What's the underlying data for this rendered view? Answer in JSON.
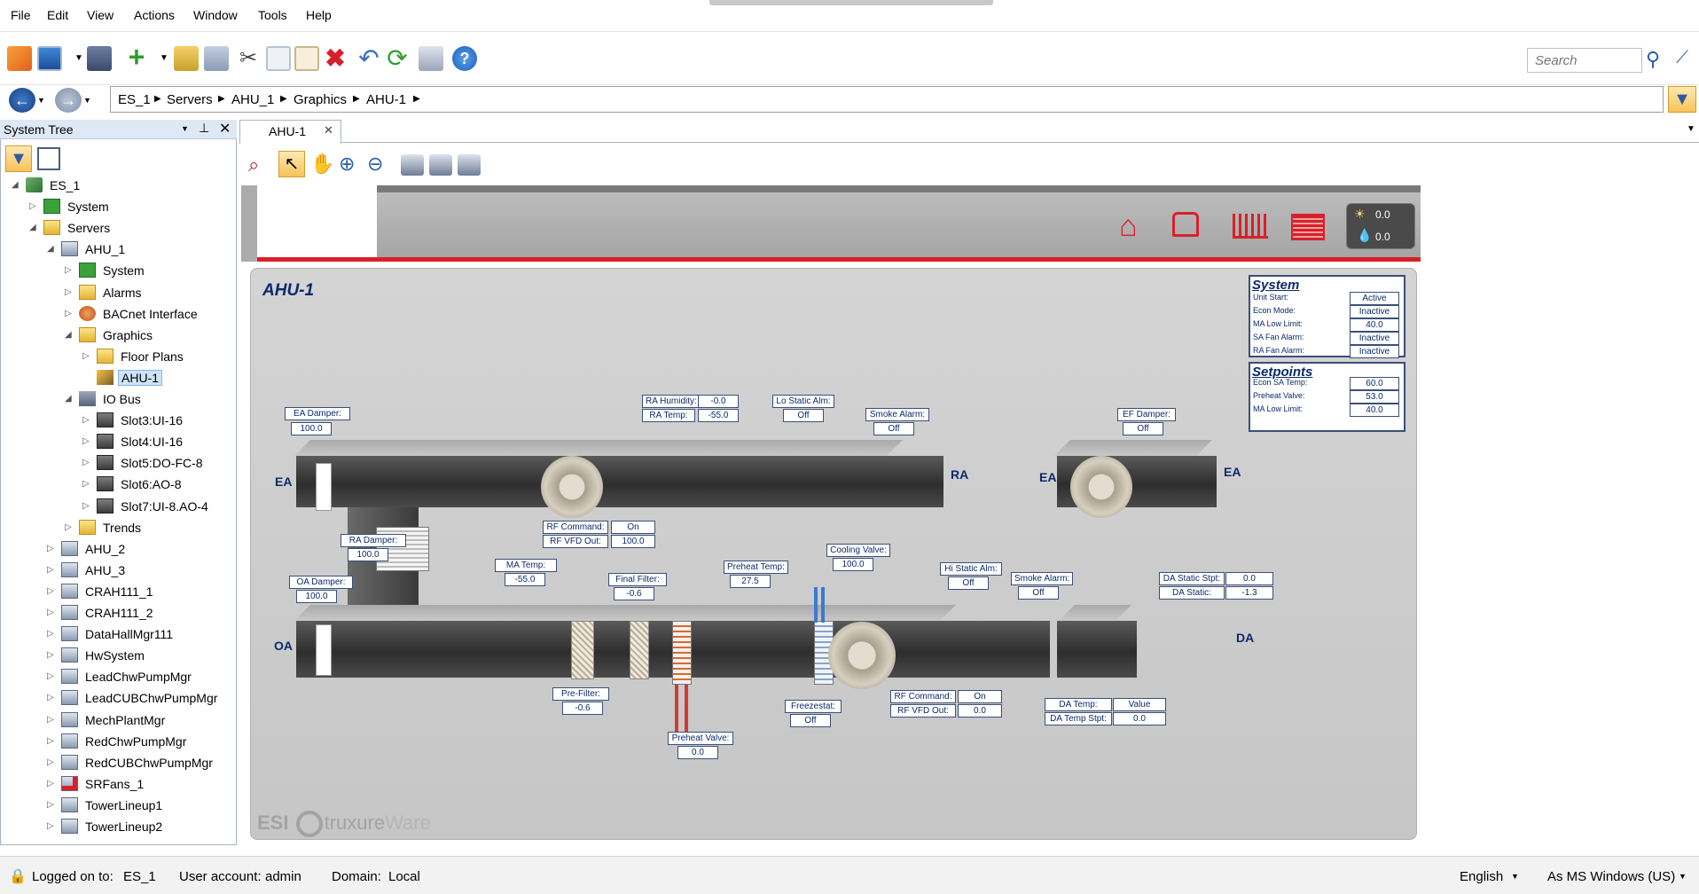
{
  "menu": [
    "File",
    "Edit",
    "View",
    "Actions",
    "Window",
    "Tools",
    "Help"
  ],
  "toolbar": {
    "search_placeholder": "Search"
  },
  "breadcrumb": [
    "ES_1",
    "Servers",
    "AHU_1",
    "Graphics",
    "AHU-1"
  ],
  "tree": {
    "title": "System Tree",
    "items": [
      {
        "label": "ES_1",
        "level": 0,
        "icon": "server-root-icon",
        "exp": "down"
      },
      {
        "label": "System",
        "level": 1,
        "icon": "system-icon",
        "exp": "right"
      },
      {
        "label": "Servers",
        "level": 1,
        "icon": "folder-icon",
        "exp": "down"
      },
      {
        "label": "AHU_1",
        "level": 2,
        "icon": "server-icon",
        "exp": "down"
      },
      {
        "label": "System",
        "level": 3,
        "icon": "system-icon",
        "exp": "right"
      },
      {
        "label": "Alarms",
        "level": 3,
        "icon": "folder-icon",
        "exp": "right"
      },
      {
        "label": "BACnet Interface",
        "level": 3,
        "icon": "bacnet-icon",
        "exp": "right"
      },
      {
        "label": "Graphics",
        "level": 3,
        "icon": "folder-icon",
        "exp": "down"
      },
      {
        "label": "Floor Plans",
        "level": 4,
        "icon": "folder-icon",
        "exp": "right"
      },
      {
        "label": "AHU-1",
        "level": 4,
        "icon": "graphic-icon",
        "exp": "",
        "selected": true
      },
      {
        "label": "IO Bus",
        "level": 3,
        "icon": "io-bus-icon",
        "exp": "down"
      },
      {
        "label": "Slot3:UI-16",
        "level": 4,
        "icon": "module-icon",
        "exp": "right"
      },
      {
        "label": "Slot4:UI-16",
        "level": 4,
        "icon": "module-icon",
        "exp": "right"
      },
      {
        "label": "Slot5:DO-FC-8",
        "level": 4,
        "icon": "module-icon",
        "exp": "right"
      },
      {
        "label": "Slot6:AO-8",
        "level": 4,
        "icon": "module-icon",
        "exp": "right"
      },
      {
        "label": "Slot7:UI-8.AO-4",
        "level": 4,
        "icon": "module-icon",
        "exp": "right"
      },
      {
        "label": "Trends",
        "level": 3,
        "icon": "folder-icon",
        "exp": "right"
      },
      {
        "label": "AHU_2",
        "level": 2,
        "icon": "server-icon",
        "exp": "right"
      },
      {
        "label": "AHU_3",
        "level": 2,
        "icon": "server-icon",
        "exp": "right"
      },
      {
        "label": "CRAH111_1",
        "level": 2,
        "icon": "server-icon",
        "exp": "right"
      },
      {
        "label": "CRAH111_2",
        "level": 2,
        "icon": "server-icon",
        "exp": "right"
      },
      {
        "label": "DataHallMgr111",
        "level": 2,
        "icon": "server-icon",
        "exp": "right"
      },
      {
        "label": "HwSystem",
        "level": 2,
        "icon": "server-icon",
        "exp": "right"
      },
      {
        "label": "LeadChwPumpMgr",
        "level": 2,
        "icon": "server-icon",
        "exp": "right"
      },
      {
        "label": "LeadCUBChwPumpMgr",
        "level": 2,
        "icon": "server-icon",
        "exp": "right"
      },
      {
        "label": "MechPlantMgr",
        "level": 2,
        "icon": "server-icon",
        "exp": "right"
      },
      {
        "label": "RedChwPumpMgr",
        "level": 2,
        "icon": "server-icon",
        "exp": "right"
      },
      {
        "label": "RedCUBChwPumpMgr",
        "level": 2,
        "icon": "server-icon",
        "exp": "right"
      },
      {
        "label": "SRFans_1",
        "level": 2,
        "icon": "server-alarm-icon",
        "exp": "right"
      },
      {
        "label": "TowerLineup1",
        "level": 2,
        "icon": "server-icon",
        "exp": "right"
      },
      {
        "label": "TowerLineup2",
        "level": 2,
        "icon": "server-icon",
        "exp": "right"
      }
    ]
  },
  "tab": {
    "label": "AHU-1"
  },
  "graphic": {
    "title": "AHU-1",
    "weather": {
      "temp": "0.0",
      "humidity": "0.0"
    },
    "system_panel": {
      "title": "System",
      "rows": [
        {
          "label": "Unit Start:",
          "value": "Active"
        },
        {
          "label": "Econ Mode:",
          "value": "Inactive"
        },
        {
          "label": "MA Low Limit:",
          "value": "40.0"
        },
        {
          "label": "SA Fan Alarm:",
          "value": "Inactive"
        },
        {
          "label": "RA Fan Alarm:",
          "value": "Inactive"
        }
      ]
    },
    "setpoints_panel": {
      "title": "Setpoints",
      "rows": [
        {
          "label": "Econ SA Temp:",
          "value": "60.0"
        },
        {
          "label": "Preheat Valve:",
          "value": "53.0"
        },
        {
          "label": "MA Low Limit:",
          "value": "40.0"
        }
      ]
    },
    "air_labels": {
      "ea_left": "EA",
      "ra": "RA",
      "ea_right_1": "EA",
      "ea_right_2": "EA",
      "oa": "OA",
      "da": "DA"
    },
    "points": {
      "ea_damper": {
        "label": "EA Damper:",
        "value": "100.0"
      },
      "ra_humidity": {
        "label": "RA Humidity:",
        "value": "-0.0"
      },
      "ra_temp": {
        "label": "RA Temp:",
        "value": "-55.0"
      },
      "lo_static": {
        "label": "Lo Static Alm:",
        "value": "Off"
      },
      "smoke_ra": {
        "label": "Smoke Alarm:",
        "value": "Off"
      },
      "ef_damper": {
        "label": "EF Damper:",
        "value": "Off"
      },
      "rf_command": {
        "label": "RF Command:",
        "value": "On"
      },
      "rf_vfd": {
        "label": "RF VFD Out:",
        "value": "100.0"
      },
      "ra_damper": {
        "label": "RA Damper:",
        "value": "100.0"
      },
      "oa_damper": {
        "label": "OA Damper:",
        "value": "100.0"
      },
      "ma_temp": {
        "label": "MA Temp:",
        "value": "-55.0"
      },
      "final_filter": {
        "label": "Final Filter:",
        "value": "-0.6"
      },
      "preheat_temp": {
        "label": "Preheat Temp:",
        "value": "27.5"
      },
      "cooling_valve": {
        "label": "Cooling Valve:",
        "value": "100.0"
      },
      "hi_static": {
        "label": "Hi Static Alm:",
        "value": "Off"
      },
      "smoke_sa": {
        "label": "Smoke Alarm:",
        "value": "Off"
      },
      "da_static_stpt": {
        "label": "DA Static Stpt:",
        "value": "0.0"
      },
      "da_static": {
        "label": "DA Static:",
        "value": "-1.3"
      },
      "pre_filter": {
        "label": "Pre-Filter:",
        "value": "-0.6"
      },
      "freezestat": {
        "label": "Freezestat:",
        "value": "Off"
      },
      "sf_command": {
        "label": "RF Command:",
        "value": "On"
      },
      "sf_vfd": {
        "label": "RF VFD Out:",
        "value": "0.0"
      },
      "preheat_valve": {
        "label": "Preheat Valve:",
        "value": "0.0"
      },
      "da_temp": {
        "label": "DA Temp:",
        "value": "Value"
      },
      "da_temp_stpt": {
        "label": "DA Temp Stpt:",
        "value": "0.0"
      }
    },
    "logo": {
      "prefix": "ESI",
      "brand_a": "truxure",
      "brand_b": "Ware"
    }
  },
  "status": {
    "logged_on_label": "Logged on to:",
    "logged_on_value": "ES_1",
    "user_label": "User account:",
    "user_value": "admin",
    "domain_label": "Domain:",
    "domain_value": "Local",
    "language": "English",
    "time_format": "As MS Windows (US)"
  },
  "colors": {
    "accent_red": "#d8202a",
    "label_blue": "#0b2a6b",
    "tree_select": "#cde3f7"
  }
}
